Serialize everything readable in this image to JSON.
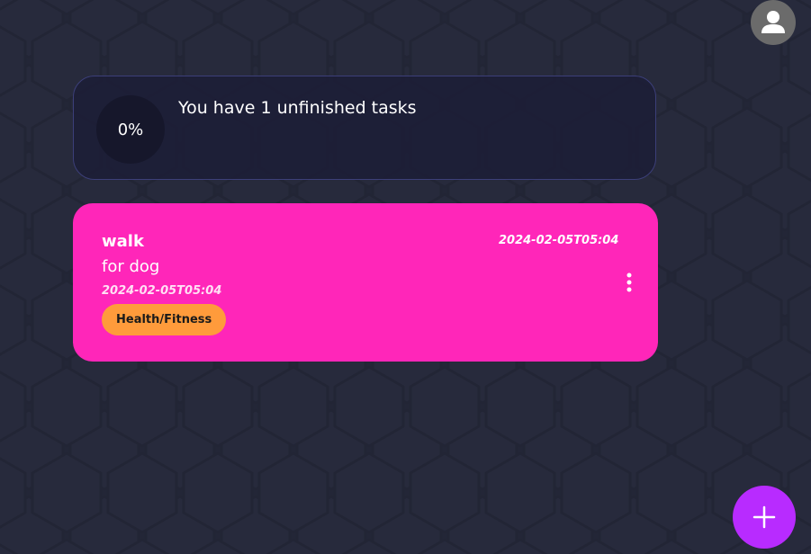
{
  "header": {
    "avatar_icon": "user-icon"
  },
  "summary": {
    "progress_percent": "0%",
    "message": "You have 1 unfinished tasks"
  },
  "tasks": [
    {
      "title": "walk",
      "description": "for dog",
      "date": "2024-02-05T05:04",
      "deadline": "2024-02-05T05:04",
      "category": "Health/Fitness",
      "card_color": "#ff26b9",
      "category_color": "#ff9b3b",
      "menu_icon": "more-vertical-icon"
    }
  ],
  "actions": {
    "add_icon": "plus-icon"
  },
  "colors": {
    "background": "#232637",
    "fab": "#b82bff",
    "card_border": "#3c3f79"
  }
}
